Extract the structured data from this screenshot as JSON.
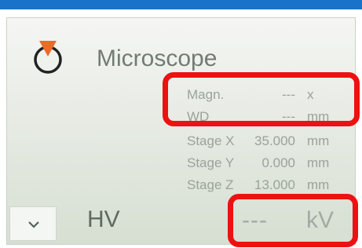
{
  "panel": {
    "title": "Microscope",
    "rows": [
      {
        "label": "Magn.",
        "value": "---",
        "unit": "x"
      },
      {
        "label": "WD",
        "value": "---",
        "unit": "mm"
      },
      {
        "label": "Stage X",
        "value": "35.000",
        "unit": "mm"
      },
      {
        "label": "Stage Y",
        "value": "0.000",
        "unit": "mm"
      },
      {
        "label": "Stage Z",
        "value": "13.000",
        "unit": "mm"
      }
    ],
    "hv": {
      "label": "HV",
      "value": "---",
      "unit": "kV"
    }
  },
  "colors": {
    "top_bar": "#1a73c9",
    "highlight": "#ee1111",
    "power_icon_accent": "#ee6a2a"
  },
  "icons": {
    "power": "power-icon",
    "dropdown": "chevron-down-icon"
  }
}
